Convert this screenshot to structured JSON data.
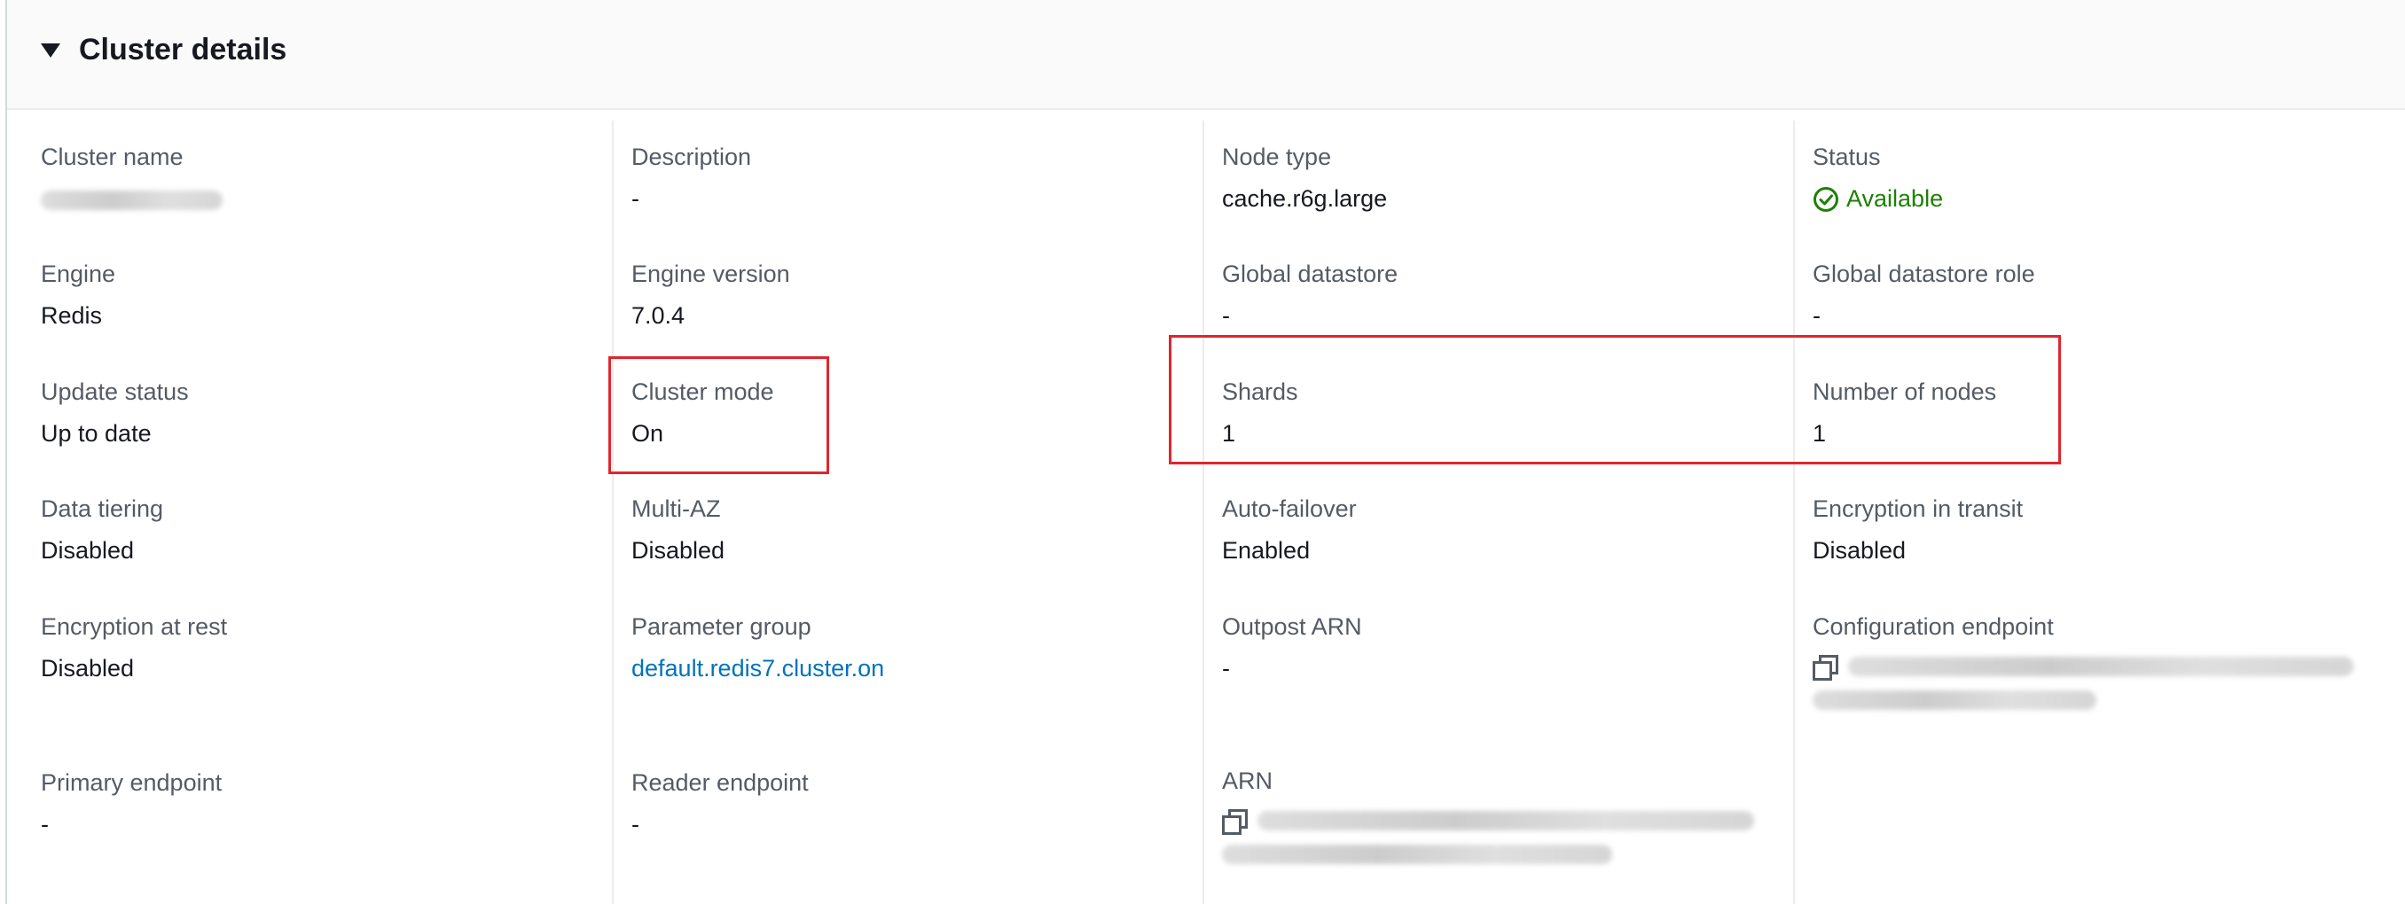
{
  "panel": {
    "title": "Cluster details"
  },
  "fields": {
    "cluster_name": {
      "label": "Cluster name"
    },
    "description": {
      "label": "Description",
      "value": "-"
    },
    "node_type": {
      "label": "Node type",
      "value": "cache.r6g.large"
    },
    "status": {
      "label": "Status",
      "value": "Available"
    },
    "engine": {
      "label": "Engine",
      "value": "Redis"
    },
    "engine_version": {
      "label": "Engine version",
      "value": "7.0.4"
    },
    "global_datastore": {
      "label": "Global datastore",
      "value": "-"
    },
    "global_datastore_role": {
      "label": "Global datastore role",
      "value": "-"
    },
    "update_status": {
      "label": "Update status",
      "value": "Up to date"
    },
    "cluster_mode": {
      "label": "Cluster mode",
      "value": "On"
    },
    "shards": {
      "label": "Shards",
      "value": "1"
    },
    "number_of_nodes": {
      "label": "Number of nodes",
      "value": "1"
    },
    "data_tiering": {
      "label": "Data tiering",
      "value": "Disabled"
    },
    "multi_az": {
      "label": "Multi-AZ",
      "value": "Disabled"
    },
    "auto_failover": {
      "label": "Auto-failover",
      "value": "Enabled"
    },
    "encryption_in_transit": {
      "label": "Encryption in transit",
      "value": "Disabled"
    },
    "encryption_at_rest": {
      "label": "Encryption at rest",
      "value": "Disabled"
    },
    "parameter_group": {
      "label": "Parameter group",
      "value": "default.redis7.cluster.on"
    },
    "outpost_arn": {
      "label": "Outpost ARN",
      "value": "-"
    },
    "configuration_endpoint": {
      "label": "Configuration endpoint"
    },
    "primary_endpoint": {
      "label": "Primary endpoint",
      "value": "-"
    },
    "reader_endpoint": {
      "label": "Reader endpoint",
      "value": "-"
    },
    "arn": {
      "label": "ARN"
    }
  },
  "colors": {
    "status_ok": "#1d8102",
    "link": "#0073bb",
    "highlight": "#e0262c"
  },
  "icons": {
    "collapse": "caret-down-icon",
    "status": "check-circle-icon",
    "copy": "copy-icon"
  }
}
